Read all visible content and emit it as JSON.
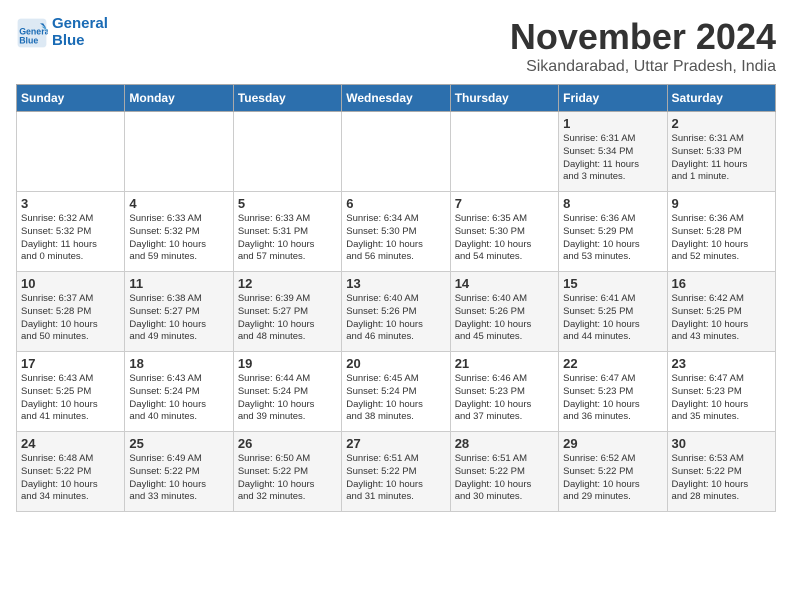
{
  "logo": {
    "line1": "General",
    "line2": "Blue"
  },
  "title": "November 2024",
  "location": "Sikandarabad, Uttar Pradesh, India",
  "headers": [
    "Sunday",
    "Monday",
    "Tuesday",
    "Wednesday",
    "Thursday",
    "Friday",
    "Saturday"
  ],
  "rows": [
    [
      {
        "day": "",
        "info": ""
      },
      {
        "day": "",
        "info": ""
      },
      {
        "day": "",
        "info": ""
      },
      {
        "day": "",
        "info": ""
      },
      {
        "day": "",
        "info": ""
      },
      {
        "day": "1",
        "info": "Sunrise: 6:31 AM\nSunset: 5:34 PM\nDaylight: 11 hours\nand 3 minutes."
      },
      {
        "day": "2",
        "info": "Sunrise: 6:31 AM\nSunset: 5:33 PM\nDaylight: 11 hours\nand 1 minute."
      }
    ],
    [
      {
        "day": "3",
        "info": "Sunrise: 6:32 AM\nSunset: 5:32 PM\nDaylight: 11 hours\nand 0 minutes."
      },
      {
        "day": "4",
        "info": "Sunrise: 6:33 AM\nSunset: 5:32 PM\nDaylight: 10 hours\nand 59 minutes."
      },
      {
        "day": "5",
        "info": "Sunrise: 6:33 AM\nSunset: 5:31 PM\nDaylight: 10 hours\nand 57 minutes."
      },
      {
        "day": "6",
        "info": "Sunrise: 6:34 AM\nSunset: 5:30 PM\nDaylight: 10 hours\nand 56 minutes."
      },
      {
        "day": "7",
        "info": "Sunrise: 6:35 AM\nSunset: 5:30 PM\nDaylight: 10 hours\nand 54 minutes."
      },
      {
        "day": "8",
        "info": "Sunrise: 6:36 AM\nSunset: 5:29 PM\nDaylight: 10 hours\nand 53 minutes."
      },
      {
        "day": "9",
        "info": "Sunrise: 6:36 AM\nSunset: 5:28 PM\nDaylight: 10 hours\nand 52 minutes."
      }
    ],
    [
      {
        "day": "10",
        "info": "Sunrise: 6:37 AM\nSunset: 5:28 PM\nDaylight: 10 hours\nand 50 minutes."
      },
      {
        "day": "11",
        "info": "Sunrise: 6:38 AM\nSunset: 5:27 PM\nDaylight: 10 hours\nand 49 minutes."
      },
      {
        "day": "12",
        "info": "Sunrise: 6:39 AM\nSunset: 5:27 PM\nDaylight: 10 hours\nand 48 minutes."
      },
      {
        "day": "13",
        "info": "Sunrise: 6:40 AM\nSunset: 5:26 PM\nDaylight: 10 hours\nand 46 minutes."
      },
      {
        "day": "14",
        "info": "Sunrise: 6:40 AM\nSunset: 5:26 PM\nDaylight: 10 hours\nand 45 minutes."
      },
      {
        "day": "15",
        "info": "Sunrise: 6:41 AM\nSunset: 5:25 PM\nDaylight: 10 hours\nand 44 minutes."
      },
      {
        "day": "16",
        "info": "Sunrise: 6:42 AM\nSunset: 5:25 PM\nDaylight: 10 hours\nand 43 minutes."
      }
    ],
    [
      {
        "day": "17",
        "info": "Sunrise: 6:43 AM\nSunset: 5:25 PM\nDaylight: 10 hours\nand 41 minutes."
      },
      {
        "day": "18",
        "info": "Sunrise: 6:43 AM\nSunset: 5:24 PM\nDaylight: 10 hours\nand 40 minutes."
      },
      {
        "day": "19",
        "info": "Sunrise: 6:44 AM\nSunset: 5:24 PM\nDaylight: 10 hours\nand 39 minutes."
      },
      {
        "day": "20",
        "info": "Sunrise: 6:45 AM\nSunset: 5:24 PM\nDaylight: 10 hours\nand 38 minutes."
      },
      {
        "day": "21",
        "info": "Sunrise: 6:46 AM\nSunset: 5:23 PM\nDaylight: 10 hours\nand 37 minutes."
      },
      {
        "day": "22",
        "info": "Sunrise: 6:47 AM\nSunset: 5:23 PM\nDaylight: 10 hours\nand 36 minutes."
      },
      {
        "day": "23",
        "info": "Sunrise: 6:47 AM\nSunset: 5:23 PM\nDaylight: 10 hours\nand 35 minutes."
      }
    ],
    [
      {
        "day": "24",
        "info": "Sunrise: 6:48 AM\nSunset: 5:22 PM\nDaylight: 10 hours\nand 34 minutes."
      },
      {
        "day": "25",
        "info": "Sunrise: 6:49 AM\nSunset: 5:22 PM\nDaylight: 10 hours\nand 33 minutes."
      },
      {
        "day": "26",
        "info": "Sunrise: 6:50 AM\nSunset: 5:22 PM\nDaylight: 10 hours\nand 32 minutes."
      },
      {
        "day": "27",
        "info": "Sunrise: 6:51 AM\nSunset: 5:22 PM\nDaylight: 10 hours\nand 31 minutes."
      },
      {
        "day": "28",
        "info": "Sunrise: 6:51 AM\nSunset: 5:22 PM\nDaylight: 10 hours\nand 30 minutes."
      },
      {
        "day": "29",
        "info": "Sunrise: 6:52 AM\nSunset: 5:22 PM\nDaylight: 10 hours\nand 29 minutes."
      },
      {
        "day": "30",
        "info": "Sunrise: 6:53 AM\nSunset: 5:22 PM\nDaylight: 10 hours\nand 28 minutes."
      }
    ]
  ]
}
